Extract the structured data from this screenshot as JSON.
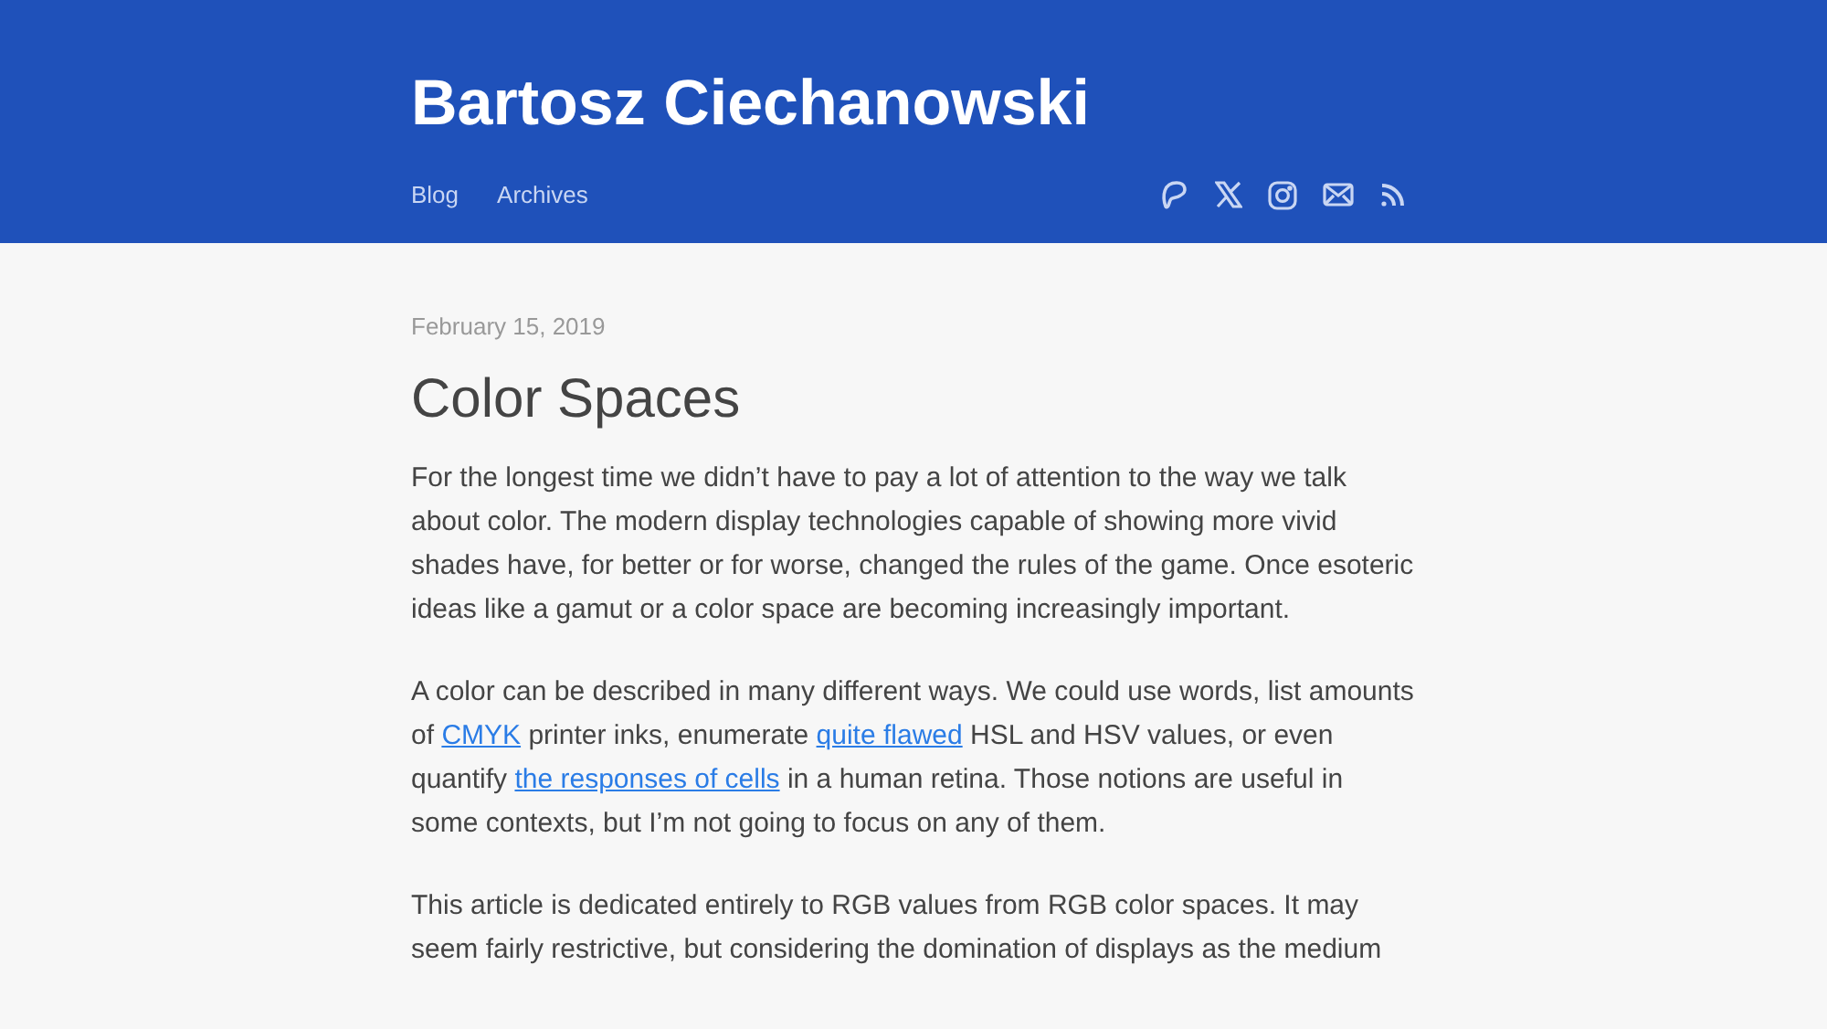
{
  "header": {
    "site_title": "Bartosz Ciechanowski",
    "nav": [
      {
        "label": "Blog"
      },
      {
        "label": "Archives"
      }
    ],
    "social_icons": [
      {
        "kind": "patreon"
      },
      {
        "kind": "x"
      },
      {
        "kind": "instagram"
      },
      {
        "kind": "mail"
      },
      {
        "kind": "rss"
      }
    ]
  },
  "article": {
    "date": "February 15, 2019",
    "title": "Color Spaces",
    "paragraphs": [
      [
        {
          "kind": "text",
          "text": "For the longest time we didn’t have to pay a lot of attention to the way we talk about color. The modern display technologies capable of showing more vivid shades have, for better or for worse, changed the rules of the game. Once esoteric ideas like a gamut or a color space are becoming increasingly important."
        }
      ],
      [
        {
          "kind": "text",
          "text": "A color can be described in many different ways. We could use words, list amounts of "
        },
        {
          "kind": "link",
          "text": "CMYK"
        },
        {
          "kind": "text",
          "text": " printer inks, enumerate "
        },
        {
          "kind": "link",
          "text": "quite flawed"
        },
        {
          "kind": "text",
          "text": " HSL and HSV values, or even quantify "
        },
        {
          "kind": "link",
          "text": "the responses of cells"
        },
        {
          "kind": "text",
          "text": " in a human retina. Those notions are useful in some contexts, but I’m not going to focus on any of them."
        }
      ],
      [
        {
          "kind": "text",
          "text": "This article is dedicated entirely to RGB values from RGB color spaces. It may seem fairly restrictive, but considering the domination of displays as the medium"
        }
      ]
    ]
  }
}
